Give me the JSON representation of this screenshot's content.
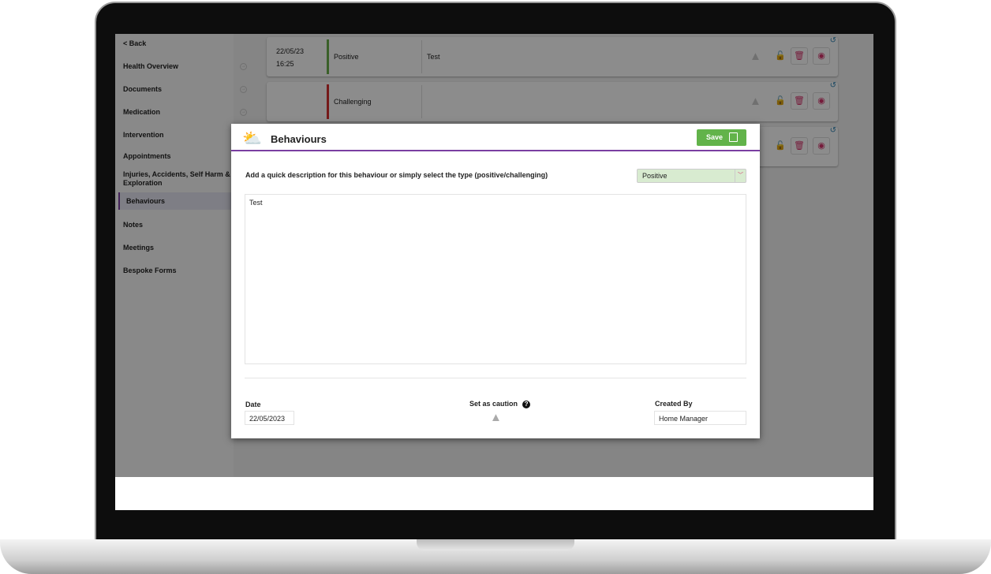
{
  "sidebar": {
    "back": "< Back",
    "items": [
      {
        "label": "Health Overview"
      },
      {
        "label": "Documents"
      },
      {
        "label": "Medication"
      },
      {
        "label": "Intervention"
      },
      {
        "label": "Appointments"
      },
      {
        "label": "Injuries, Accidents, Self Harm & Exploration"
      },
      {
        "label": "Behaviours",
        "active": true
      },
      {
        "label": "Notes"
      },
      {
        "label": "Meetings"
      },
      {
        "label": "Bespoke Forms"
      }
    ]
  },
  "rows": [
    {
      "date": "22/05/23",
      "time": "16:25",
      "type": "Positive",
      "type_color": "#6ab04c",
      "description": "Test"
    },
    {
      "date": "",
      "time": "",
      "type": "Challenging",
      "type_color": "#d63031",
      "description": ""
    },
    {
      "date": "",
      "time": "",
      "type": "",
      "type_color": "",
      "description": ""
    }
  ],
  "modal": {
    "title": "Behaviours",
    "icon": "sun-cloud-icon",
    "save_label": "Save",
    "prompt": "Add a quick description for this behaviour or simply select the type (positive/challenging)",
    "type_value": "Positive",
    "description": "Test",
    "date_label": "Date",
    "date_value": "22/05/2023",
    "caution_label": "Set as caution",
    "created_by_label": "Created By",
    "created_by_value": "Home Manager"
  },
  "colors": {
    "accent": "#7a3ea1",
    "save": "#62b34a",
    "positive": "#6ab04c",
    "challenging": "#d63031"
  }
}
